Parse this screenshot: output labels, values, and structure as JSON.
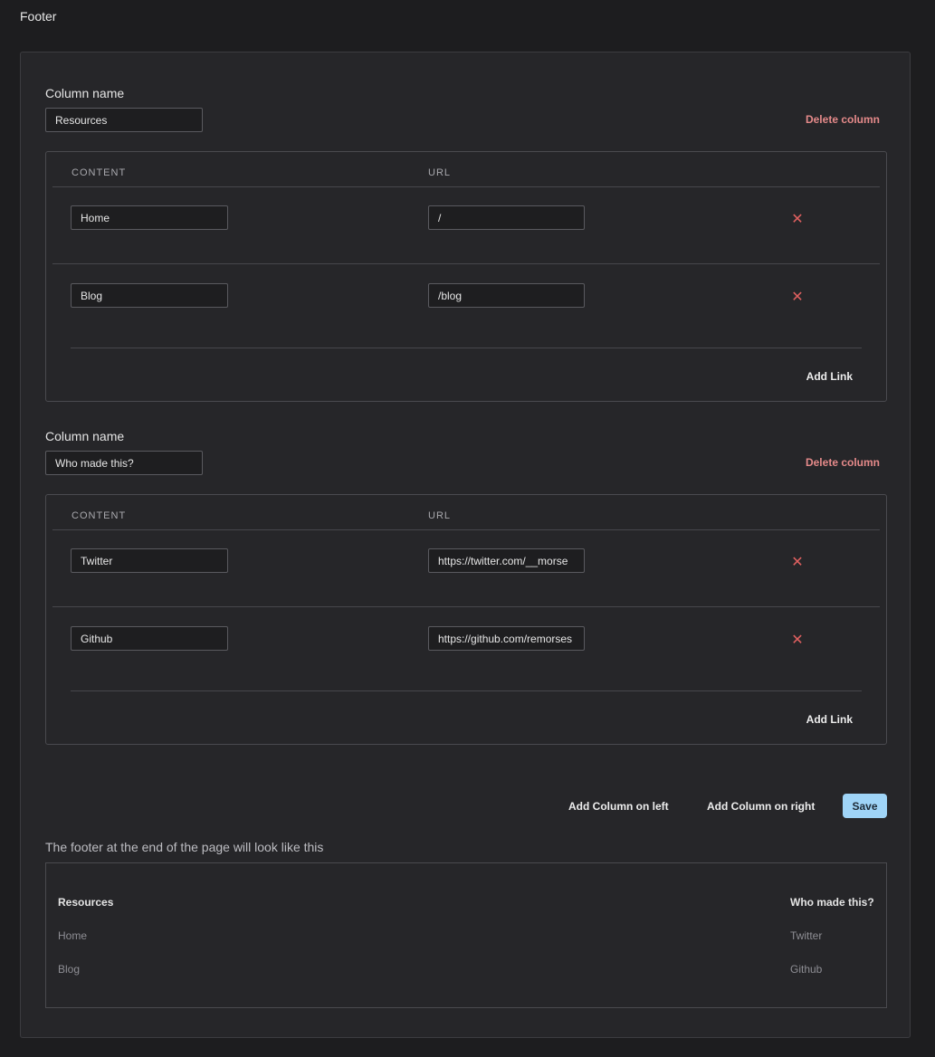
{
  "page": {
    "title": "Footer"
  },
  "columns": [
    {
      "label": "Column name",
      "name": "Resources",
      "delete_label": "Delete column",
      "headers": {
        "content": "CONTENT",
        "url": "URL"
      },
      "links": [
        {
          "content": "Home",
          "url": "/"
        },
        {
          "content": "Blog",
          "url": "/blog"
        }
      ],
      "add_link_label": "Add Link"
    },
    {
      "label": "Column name",
      "name": "Who made this?",
      "delete_label": "Delete column",
      "headers": {
        "content": "CONTENT",
        "url": "URL"
      },
      "links": [
        {
          "content": "Twitter",
          "url": "https://twitter.com/__morse"
        },
        {
          "content": "Github",
          "url": "https://github.com/remorses"
        }
      ],
      "add_link_label": "Add Link"
    }
  ],
  "actions": {
    "add_left": "Add Column on left",
    "add_right": "Add Column on right",
    "save": "Save"
  },
  "preview": {
    "caption": "The footer at the end of the page will look like this",
    "columns": [
      {
        "title": "Resources",
        "links": [
          "Home",
          "Blog"
        ]
      },
      {
        "title": "Who made this?",
        "links": [
          "Twitter",
          "Github"
        ]
      }
    ]
  },
  "icons": {
    "remove": "close-icon"
  },
  "colors": {
    "background": "#1d1d1f",
    "panel": "#262629",
    "danger": "#e58a8a",
    "remove_x": "#e06060",
    "save_button": "#9fd4f7"
  }
}
